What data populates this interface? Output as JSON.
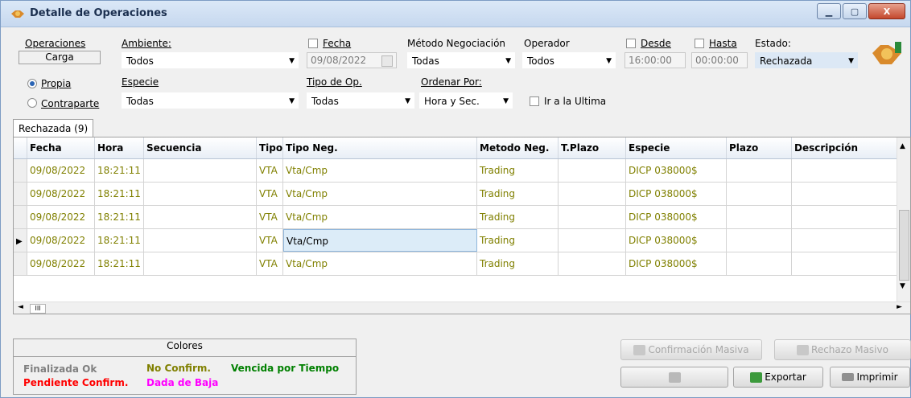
{
  "window": {
    "title": "Detalle de Operaciones"
  },
  "filters": {
    "operaciones_label": "Operaciones",
    "carga_label": "Carga",
    "radio_propia": "Propia",
    "radio_contraparte": "Contraparte",
    "ambiente_label": "Ambiente:",
    "ambiente_value": "Todos",
    "especie_label": "Especie",
    "especie_value": "Todas",
    "fecha_label": "Fecha",
    "fecha_value": "09/08/2022",
    "tipo_op_label": "Tipo de Op.",
    "tipo_op_value": "Todas",
    "metodo_label": "Método Negociación",
    "metodo_value": "Todas",
    "ordenar_label": "Ordenar Por:",
    "ordenar_value": "Hora y Sec.",
    "operador_label": "Operador",
    "operador_value": "Todos",
    "ir_ultima_label": "Ir a la Ultima",
    "desde_label": "Desde",
    "desde_value": "16:00:00",
    "hasta_label": "Hasta",
    "hasta_value": "00:00:00",
    "estado_label": "Estado:",
    "estado_value": "Rechazada"
  },
  "tab": {
    "label": "Rechazada (9)"
  },
  "grid": {
    "headers": [
      "Fecha",
      "Hora",
      "Secuencia",
      "Tipo",
      "Tipo Neg.",
      "Metodo Neg.",
      "T.Plazo",
      "Especie",
      "Plazo",
      "Descripción"
    ],
    "rows": [
      [
        "09/08/2022",
        "18:21:11",
        "",
        "VTA",
        "Vta/Cmp",
        "Trading",
        "",
        "DICP 038000$",
        "",
        ""
      ],
      [
        "09/08/2022",
        "18:21:11",
        "",
        "VTA",
        "Vta/Cmp",
        "Trading",
        "",
        "DICP 038000$",
        "",
        ""
      ],
      [
        "09/08/2022",
        "18:21:11",
        "",
        "VTA",
        "Vta/Cmp",
        "Trading",
        "",
        "DICP 038000$",
        "",
        ""
      ],
      [
        "09/08/2022",
        "18:21:11",
        "",
        "VTA",
        "Vta/Cmp",
        "Trading",
        "",
        "DICP 038000$",
        "",
        ""
      ],
      [
        "09/08/2022",
        "18:21:11",
        "",
        "VTA",
        "Vta/Cmp",
        "Trading",
        "",
        "DICP 038000$",
        "",
        ""
      ]
    ],
    "selected_row": 3,
    "scroll_mark": "III"
  },
  "legend": {
    "title": "Colores",
    "finalizada": "Finalizada Ok",
    "no_confirm": "No Confirm.",
    "vencida": "Vencida por Tiempo",
    "pendiente": "Pendiente Confirm.",
    "dada_baja": "Dada de Baja",
    "colors": {
      "finalizada": "#808080",
      "no_confirm": "#808000",
      "vencida": "#008000",
      "pendiente": "#ff0000",
      "dada_baja": "#ff00ff"
    }
  },
  "buttons": {
    "confirmacion": "Confirmación Masiva",
    "rechazo": "Rechazo Masivo",
    "exportar": "Exportar",
    "imprimir": "Imprimir"
  }
}
